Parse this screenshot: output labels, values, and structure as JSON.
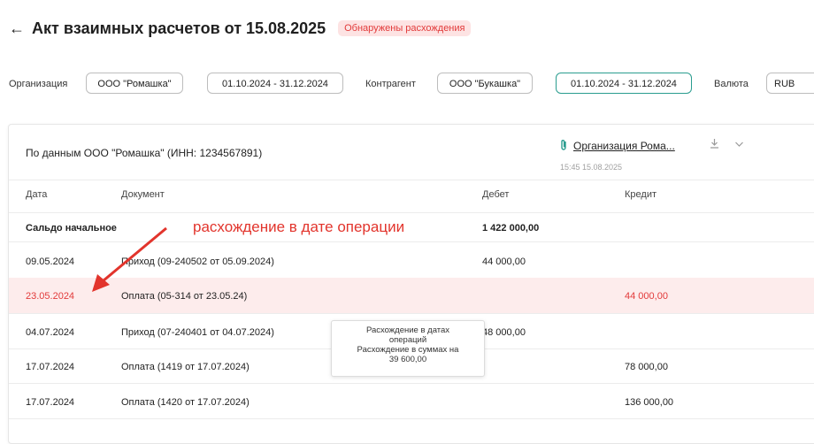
{
  "header": {
    "back_icon": "arrow-left-icon",
    "back_glyph": "←",
    "title": "Акт взаимных расчетов от 15.08.2025",
    "status_badge": "Обнаружены расхождения"
  },
  "filters": {
    "org_label": "Организация",
    "org_value": "ООО \"Ромашка\"",
    "org_period": "01.10.2024 - 31.12.2024",
    "counterparty_label": "Контрагент",
    "counterparty_value": "ООО \"Букашка\"",
    "counterparty_period": "01.10.2024 - 31.12.2024",
    "currency_label": "Валюта",
    "currency_value": "RUB"
  },
  "panel": {
    "source_title": "По данным ООО \"Ромашка\" (ИНН: 1234567891)",
    "attachment_icon": "paperclip-icon",
    "attachment_glyph": "🔗",
    "attachment_name": "Организация Рома...",
    "attachment_time": "15:45 15.08.2025",
    "download_icon": "download-icon",
    "download_glyph": "⤓",
    "expand_icon": "chevron-down-icon",
    "expand_glyph": "⌄"
  },
  "table": {
    "columns": {
      "date": "Дата",
      "document": "Документ",
      "debit": "Дебет",
      "credit": "Кредит"
    },
    "opening_label": "Сальдо начальное",
    "opening_debit": "1 422 000,00",
    "rows": [
      {
        "date": "09.05.2024",
        "document": "Приход (09-240502 от 05.09.2024)",
        "debit": "44 000,00",
        "credit": ""
      },
      {
        "date": "23.05.2024",
        "document": "Оплата (05-314 от 23.05.24)",
        "debit": "",
        "credit": "44 000,00"
      },
      {
        "date": "04.07.2024",
        "document": "Приход (07-240401 от 04.07.2024)",
        "debit": "48 000,00",
        "credit": ""
      },
      {
        "date": "17.07.2024",
        "document": "Оплата (1419 от 17.07.2024)",
        "debit": "",
        "credit": "78 000,00"
      },
      {
        "date": "17.07.2024",
        "document": "Оплата (1420 от 17.07.2024)",
        "debit": "",
        "credit": "136 000,00"
      }
    ]
  },
  "annotation": {
    "text": "расхождение в дате операции",
    "color": "#e2342c"
  },
  "tooltip": {
    "line1": "Расхождение в датах",
    "line2": "операций",
    "line3": "Расхождение в суммах на",
    "line4": "39 600,00"
  },
  "colors": {
    "accent": "#2a9d8f",
    "error": "#e23a3a",
    "highlight_row": "#fdecec"
  }
}
